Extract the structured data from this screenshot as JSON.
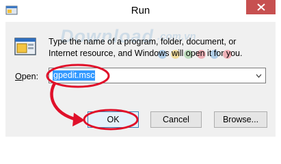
{
  "window": {
    "title": "Run"
  },
  "dialog": {
    "prompt": "Type the name of a program, folder, document, or Internet resource, and Windows will open it for you.",
    "open_label_prefix": "",
    "open_label_mnemonic": "O",
    "open_label_rest": "pen:",
    "open_value": "gpedit.msc"
  },
  "buttons": {
    "ok": "OK",
    "cancel": "Cancel",
    "browse": "Browse..."
  },
  "watermark": {
    "text": "Download",
    "sub": ".com.vn"
  },
  "colors": {
    "close_button": "#c75050",
    "selection": "#3399ff",
    "annotation": "#e0102a",
    "dialog_bg": "#f0f0f0"
  },
  "icons": [
    "run-app-icon",
    "close-icon",
    "run-program-icon",
    "chevron-down-icon"
  ]
}
